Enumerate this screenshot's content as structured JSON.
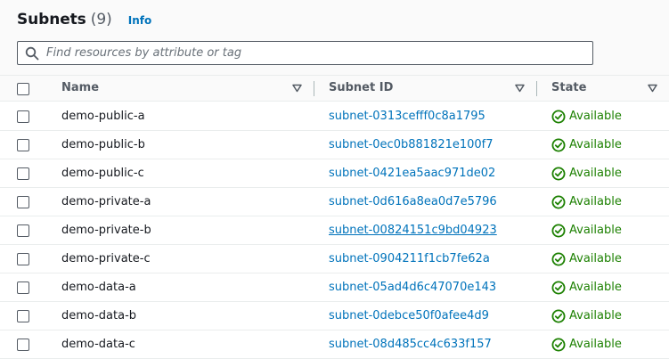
{
  "panel": {
    "title": "Subnets",
    "count": "(9)",
    "info_label": "Info"
  },
  "search": {
    "placeholder": "Find resources by attribute or tag",
    "value": ""
  },
  "columns": {
    "name": "Name",
    "subnet_id": "Subnet ID",
    "state": "State"
  },
  "rows": [
    {
      "name": "demo-public-a",
      "subnet_id": "subnet-0313cefff0c8a1795",
      "state": "Available"
    },
    {
      "name": "demo-public-b",
      "subnet_id": "subnet-0ec0b881821e100f7",
      "state": "Available"
    },
    {
      "name": "demo-public-c",
      "subnet_id": "subnet-0421ea5aac971de02",
      "state": "Available"
    },
    {
      "name": "demo-private-a",
      "subnet_id": "subnet-0d616a8ea0d7e5796",
      "state": "Available"
    },
    {
      "name": "demo-private-b",
      "subnet_id": "subnet-00824151c9bd04923",
      "state": "Available"
    },
    {
      "name": "demo-private-c",
      "subnet_id": "subnet-0904211f1cb7fe62a",
      "state": "Available"
    },
    {
      "name": "demo-data-a",
      "subnet_id": "subnet-05ad4d6c47070e143",
      "state": "Available"
    },
    {
      "name": "demo-data-b",
      "subnet_id": "subnet-0debce50f0afee4d9",
      "state": "Available"
    },
    {
      "name": "demo-data-c",
      "subnet_id": "subnet-08d485cc4c633f157",
      "state": "Available"
    }
  ],
  "icons": {
    "search": "search-icon",
    "sort": "caret-down-icon",
    "status": "status-success-icon"
  },
  "colors": {
    "link": "#0073bb",
    "success": "#1d8102",
    "header_bg": "#fafafa",
    "border": "#eaeded"
  }
}
